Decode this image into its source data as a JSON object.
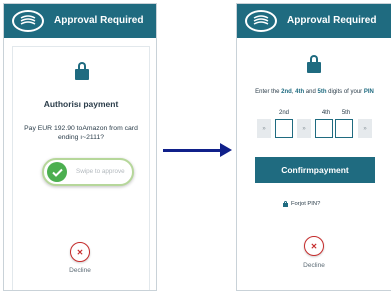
{
  "left_screen": {
    "header": {
      "title": "Approval Required",
      "logo_icon": "bank-logo-icon"
    },
    "lock_icon": "padlock-icon",
    "heading": "Authorisı payment",
    "amount_line": "Pay EUR 192.90 toAmazon from card",
    "card_line": "ending ı~2111?",
    "swipe": {
      "label": "Swipe to approve",
      "icon": "checkmark-icon",
      "accent": "#4caf50"
    },
    "decline": {
      "label": "Decline",
      "icon": "x-icon",
      "color": "#c62c2c"
    }
  },
  "right_screen": {
    "header": {
      "title": "Approval Required",
      "logo_icon": "bank-logo-icon"
    },
    "lock_icon": "padlock-icon",
    "instruction": {
      "prefix": "Enter the ",
      "d1": "2nd",
      "sep1": ", ",
      "d2": "4th",
      "sep2": " and ",
      "d3": "5th",
      "suffix": " digits of your ",
      "pin": "PIN"
    },
    "digit_labels": [
      "2nd",
      "4th",
      "5th"
    ],
    "masked_symbol": "»",
    "confirm_label": "Confirmpayment",
    "forgot_label": "Forjot PIN?",
    "decline": {
      "label": "Decline",
      "icon": "x-icon",
      "color": "#c62c2c"
    }
  },
  "colors": {
    "brand": "#1f6b80",
    "arrow": "#10208a"
  }
}
